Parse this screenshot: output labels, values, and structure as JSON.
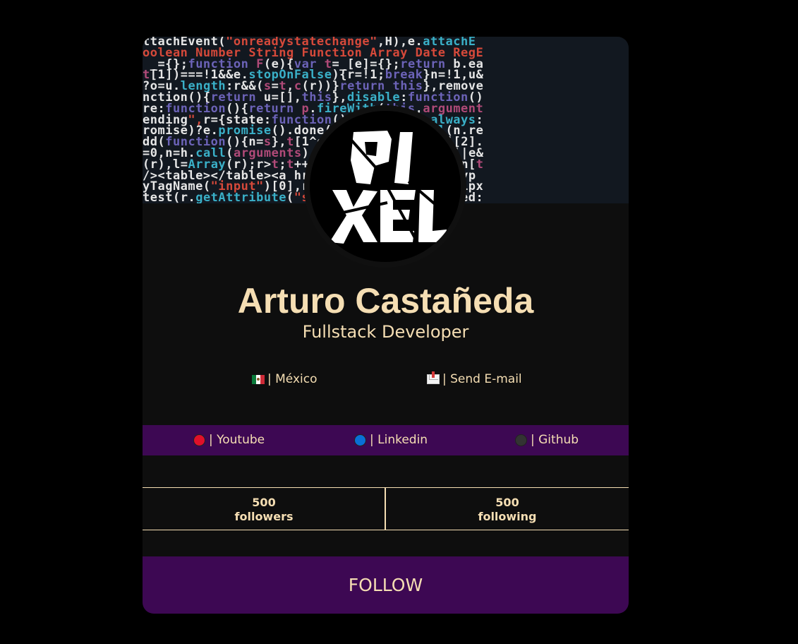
{
  "profile": {
    "name": "Arturo Castañeda",
    "title": "Fullstack Developer",
    "logo_text": "PIXEL"
  },
  "contact": {
    "location": "| México",
    "email": "| Send E-mail"
  },
  "social": {
    "youtube": "| Youtube",
    "linkedin": "| Linkedin",
    "github": "| Github"
  },
  "stats": {
    "followers_count": "500",
    "followers_label": "followers",
    "following_count": "500",
    "following_label": "following"
  },
  "follow_button": "FOLLOW",
  "banner_code": [
    "ttachEvent(\"onreadystatechange\",H),e.attachE",
    "oolean Number String Function Array Date RegE",
    " _={};function F(e){var t=_[e]={};return b.ea",
    "t[1])===!1&&e.stopOnFalse){r=!1;break}n=!1,u&",
    "?o=u.length:r&&(s=t,c(r))}return this},remove",
    "nction(){return u=[],this},disable:function()",
    "re:function(){return p.fireWith(this,argument",
    "ending\",r={state:function(){return n},always:",
    "romise)?e.promise().done(n.resolve).fail(n.re",
    "dd(function(){n=s},t[1^e][2].disable,t[2][2].",
    "=0,n=h.call(arguments),r=n.length,i=1!==r||e&",
    "(r),l=Array(r);r>t;t++)n[t]&&b.isFunction(n[t",
    "/><table></table><a href='/a'></a><input typ",
    "yTagName(\"input\")[0],r.style.cssText=\"top:1px",
    "test(r.getAttribute(\"style\")),hrefNormalized:"
  ],
  "colors": {
    "background": "#000000",
    "card": "#0e0e0e",
    "accent_purple": "#3d0853",
    "text_wheat": "#f5deb3",
    "youtube_dot": "#e0102a",
    "linkedin_dot": "#0a6fd6",
    "github_dot": "#333333"
  }
}
